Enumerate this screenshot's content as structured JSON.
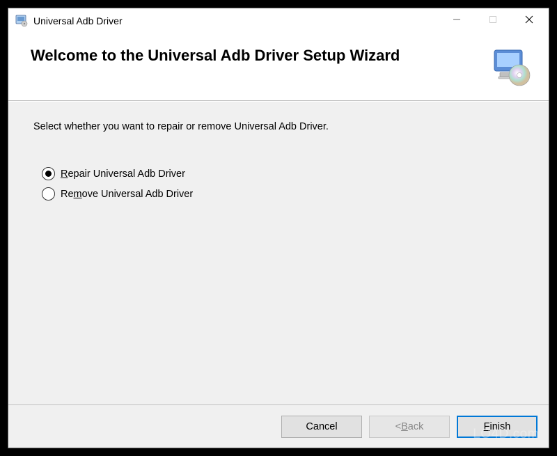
{
  "titlebar": {
    "title": "Universal Adb Driver"
  },
  "header": {
    "title": "Welcome to the Universal Adb Driver Setup Wizard"
  },
  "content": {
    "instruction": "Select whether you want to repair or remove Universal Adb Driver.",
    "options": [
      {
        "label_pre": "",
        "label_u": "R",
        "label_post": "epair Universal Adb Driver",
        "selected": true
      },
      {
        "label_pre": "Re",
        "label_u": "m",
        "label_post": "ove Universal Adb Driver",
        "selected": false
      }
    ]
  },
  "footer": {
    "cancel": "Cancel",
    "back_prefix": "< ",
    "back_u": "B",
    "back_post": "ack",
    "finish_pre": "",
    "finish_u": "F",
    "finish_post": "inish"
  },
  "watermark": "LO4D.com"
}
